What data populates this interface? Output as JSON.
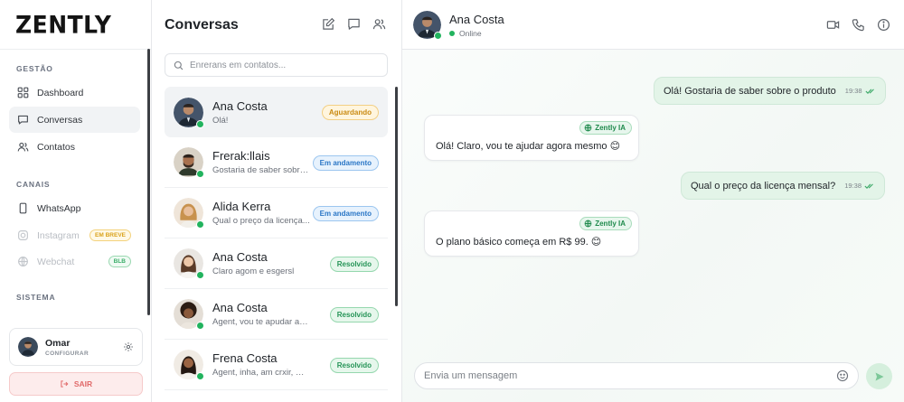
{
  "app": {
    "logo_text": "ZENTLY"
  },
  "sidebar": {
    "sections": [
      {
        "label": "GESTÃO",
        "items": [
          {
            "label": "Dashboard",
            "icon": "dashboard-icon",
            "active": false
          },
          {
            "label": "Conversas",
            "icon": "chat-icon",
            "active": true
          },
          {
            "label": "Contatos",
            "icon": "contacts-icon",
            "active": false
          }
        ]
      },
      {
        "label": "CANAIS",
        "items": [
          {
            "label": "WhatsApp",
            "icon": "phone-icon",
            "disabled": false
          },
          {
            "label": "Instagram",
            "icon": "instagram-icon",
            "disabled": true,
            "badge": "EM BREVE"
          },
          {
            "label": "Webchat",
            "icon": "globe-icon",
            "disabled": true,
            "badge": "BLB"
          }
        ]
      },
      {
        "label": "SISTEMA",
        "items": []
      }
    ],
    "user": {
      "name": "Omar",
      "subtitle": "CONFIGURAR"
    },
    "logout_label": "SAIR"
  },
  "conversations": {
    "title": "Conversas",
    "search_placeholder": "Enrerans em contatos...",
    "items": [
      {
        "name": "Ana Costa",
        "preview": "Olá!",
        "status": "Aguardando",
        "status_type": "waiting",
        "active": true,
        "avatar": "man-suit"
      },
      {
        "name": "Frerak:llais",
        "preview": "Gostaria de saber sobre...",
        "status": "Em andamento",
        "status_type": "progress",
        "active": false,
        "avatar": "man-beard"
      },
      {
        "name": "Alida Kerra",
        "preview": "Qual o preço da licença...",
        "status": "Em andamento",
        "status_type": "progress",
        "active": false,
        "avatar": "woman-blonde"
      },
      {
        "name": "Ana Costa",
        "preview": "Claro agom e esgersl",
        "status": "Resolvido",
        "status_type": "resolved",
        "active": false,
        "avatar": "woman-light"
      },
      {
        "name": "Ana Costa",
        "preview": "Agent, vou te apudar agora...",
        "status": "Resolvido",
        "status_type": "resolved",
        "active": false,
        "avatar": "woman-curly"
      },
      {
        "name": "Frena Costa",
        "preview": "Agent, inha, am crxir, mais...",
        "status": "Resolvido",
        "status_type": "resolved",
        "active": false,
        "avatar": "woman-dark"
      }
    ]
  },
  "chat": {
    "contact_name": "Ana Costa",
    "contact_status": "Online",
    "messages": [
      {
        "direction": "out",
        "text": "Olá! Gostaria de saber sobre o produto",
        "time": "19:38"
      },
      {
        "direction": "in",
        "text": "Olá! Claro, vou te ajudar agora mesmo 😊",
        "tag": "Zently IA"
      },
      {
        "direction": "out",
        "text": "Qual o preço da licença mensal?",
        "time": "19:38"
      },
      {
        "direction": "in",
        "text": "O plano básico começa em R$ 99. 😊",
        "tag": "Zently IA"
      }
    ],
    "composer_placeholder": "Envia um mensagem"
  },
  "colors": {
    "accent_green": "#22b35e",
    "bubble_out": "#e3f4e8",
    "logout_red": "#e16a6a"
  }
}
